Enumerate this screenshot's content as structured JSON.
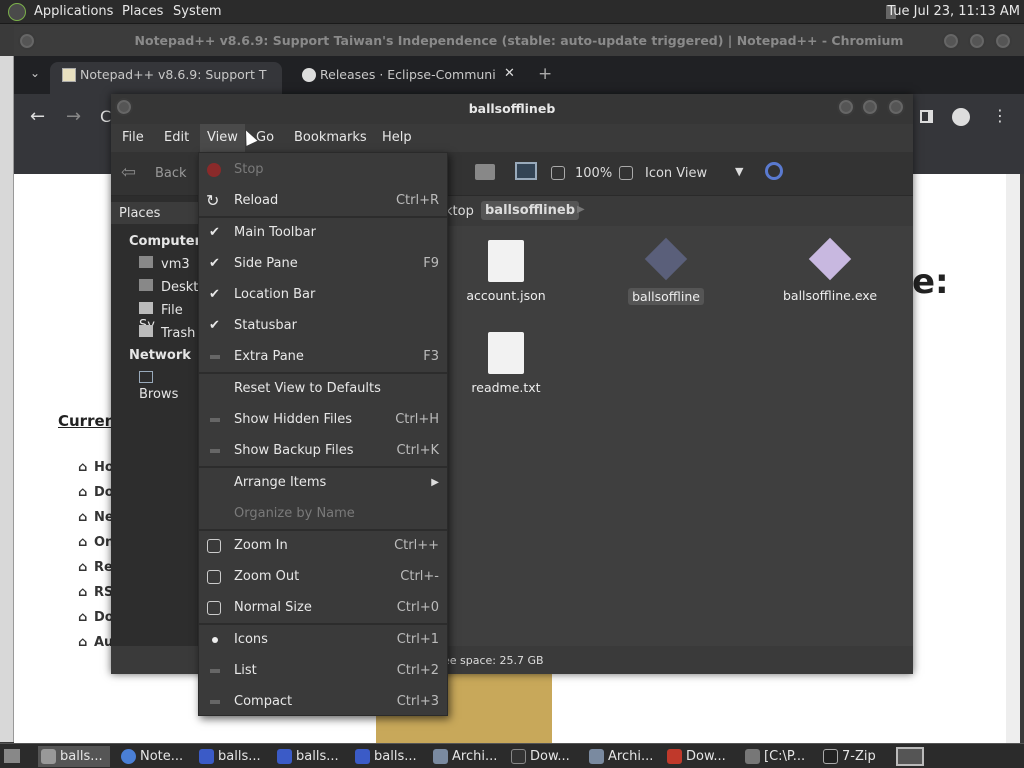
{
  "top_panel": {
    "menus": [
      "Applications",
      "Places",
      "System"
    ],
    "clock": "Tue Jul 23, 11:13 AM"
  },
  "browser": {
    "window_title": "Notepad++ v8.6.9: Support Taiwan's Independence (stable: auto-update triggered) | Notepad++ - Chromium",
    "tabs": [
      {
        "label": "Notepad++ v8.6.9: Support T"
      },
      {
        "label": "Releases · Eclipse-Communi"
      }
    ],
    "page_heading_fragment": "e:",
    "page_current": "Current",
    "page_links": [
      "Ho",
      "Do",
      "Ne",
      "On",
      "Re",
      "RS",
      "Do",
      "Au"
    ]
  },
  "file_manager": {
    "window_title": "ballsofflineb",
    "menubar": [
      "File",
      "Edit",
      "View",
      "Go",
      "Bookmarks",
      "Help"
    ],
    "toolbar": {
      "back": "Back",
      "zoom": "100%",
      "view_mode": "Icon View"
    },
    "path": {
      "prev": "ktop",
      "current": "ballsofflineb"
    },
    "sidebar": {
      "header": "Places",
      "section_computer": "Computer",
      "items": [
        "vm3",
        "Deskt",
        "File Sy",
        "Trash"
      ],
      "section_network": "Network",
      "network_items": [
        "Brows"
      ]
    },
    "files": [
      {
        "name": "account.json",
        "icon": "json-file-icon"
      },
      {
        "name": "ballsoffline",
        "icon": "executable-icon"
      },
      {
        "name": "ballsoffline.exe",
        "icon": "exe-file-icon"
      },
      {
        "name": "readme.txt",
        "icon": "text-file-icon"
      }
    ],
    "status": "ee space: 25.7 GB"
  },
  "view_menu": [
    {
      "label": "Stop",
      "accel": "",
      "disabled": true
    },
    {
      "label": "Reload",
      "accel": "Ctrl+R"
    },
    {
      "label": "Main Toolbar",
      "accel": "",
      "checked": true
    },
    {
      "label": "Side Pane",
      "accel": "F9",
      "checked": true
    },
    {
      "label": "Location Bar",
      "accel": "",
      "checked": true
    },
    {
      "label": "Statusbar",
      "accel": "",
      "checked": true
    },
    {
      "label": "Extra Pane",
      "accel": "F3"
    },
    {
      "label": "Reset View to Defaults",
      "accel": ""
    },
    {
      "label": "Show Hidden Files",
      "accel": "Ctrl+H"
    },
    {
      "label": "Show Backup Files",
      "accel": "Ctrl+K"
    },
    {
      "label": "Arrange Items",
      "accel": ""
    },
    {
      "label": "Organize by Name",
      "accel": "",
      "disabled": true
    },
    {
      "label": "Zoom In",
      "accel": "Ctrl++"
    },
    {
      "label": "Zoom Out",
      "accel": "Ctrl+-"
    },
    {
      "label": "Normal Size",
      "accel": "Ctrl+0"
    },
    {
      "label": "Icons",
      "accel": "Ctrl+1",
      "selected": true
    },
    {
      "label": "List",
      "accel": "Ctrl+2"
    },
    {
      "label": "Compact",
      "accel": "Ctrl+3"
    }
  ],
  "taskbar": [
    "balls...",
    "Note...",
    "balls...",
    "balls...",
    "balls...",
    "Archi...",
    "Dow...",
    "Archi...",
    "Dow...",
    "[C:\\P...",
    "7-Zip"
  ],
  "colors": {
    "panel": "#2b2b2b",
    "menu_bg": "#3a3a3a",
    "accent_red": "#c0392b",
    "exe_purple": "#8a7fb0"
  }
}
